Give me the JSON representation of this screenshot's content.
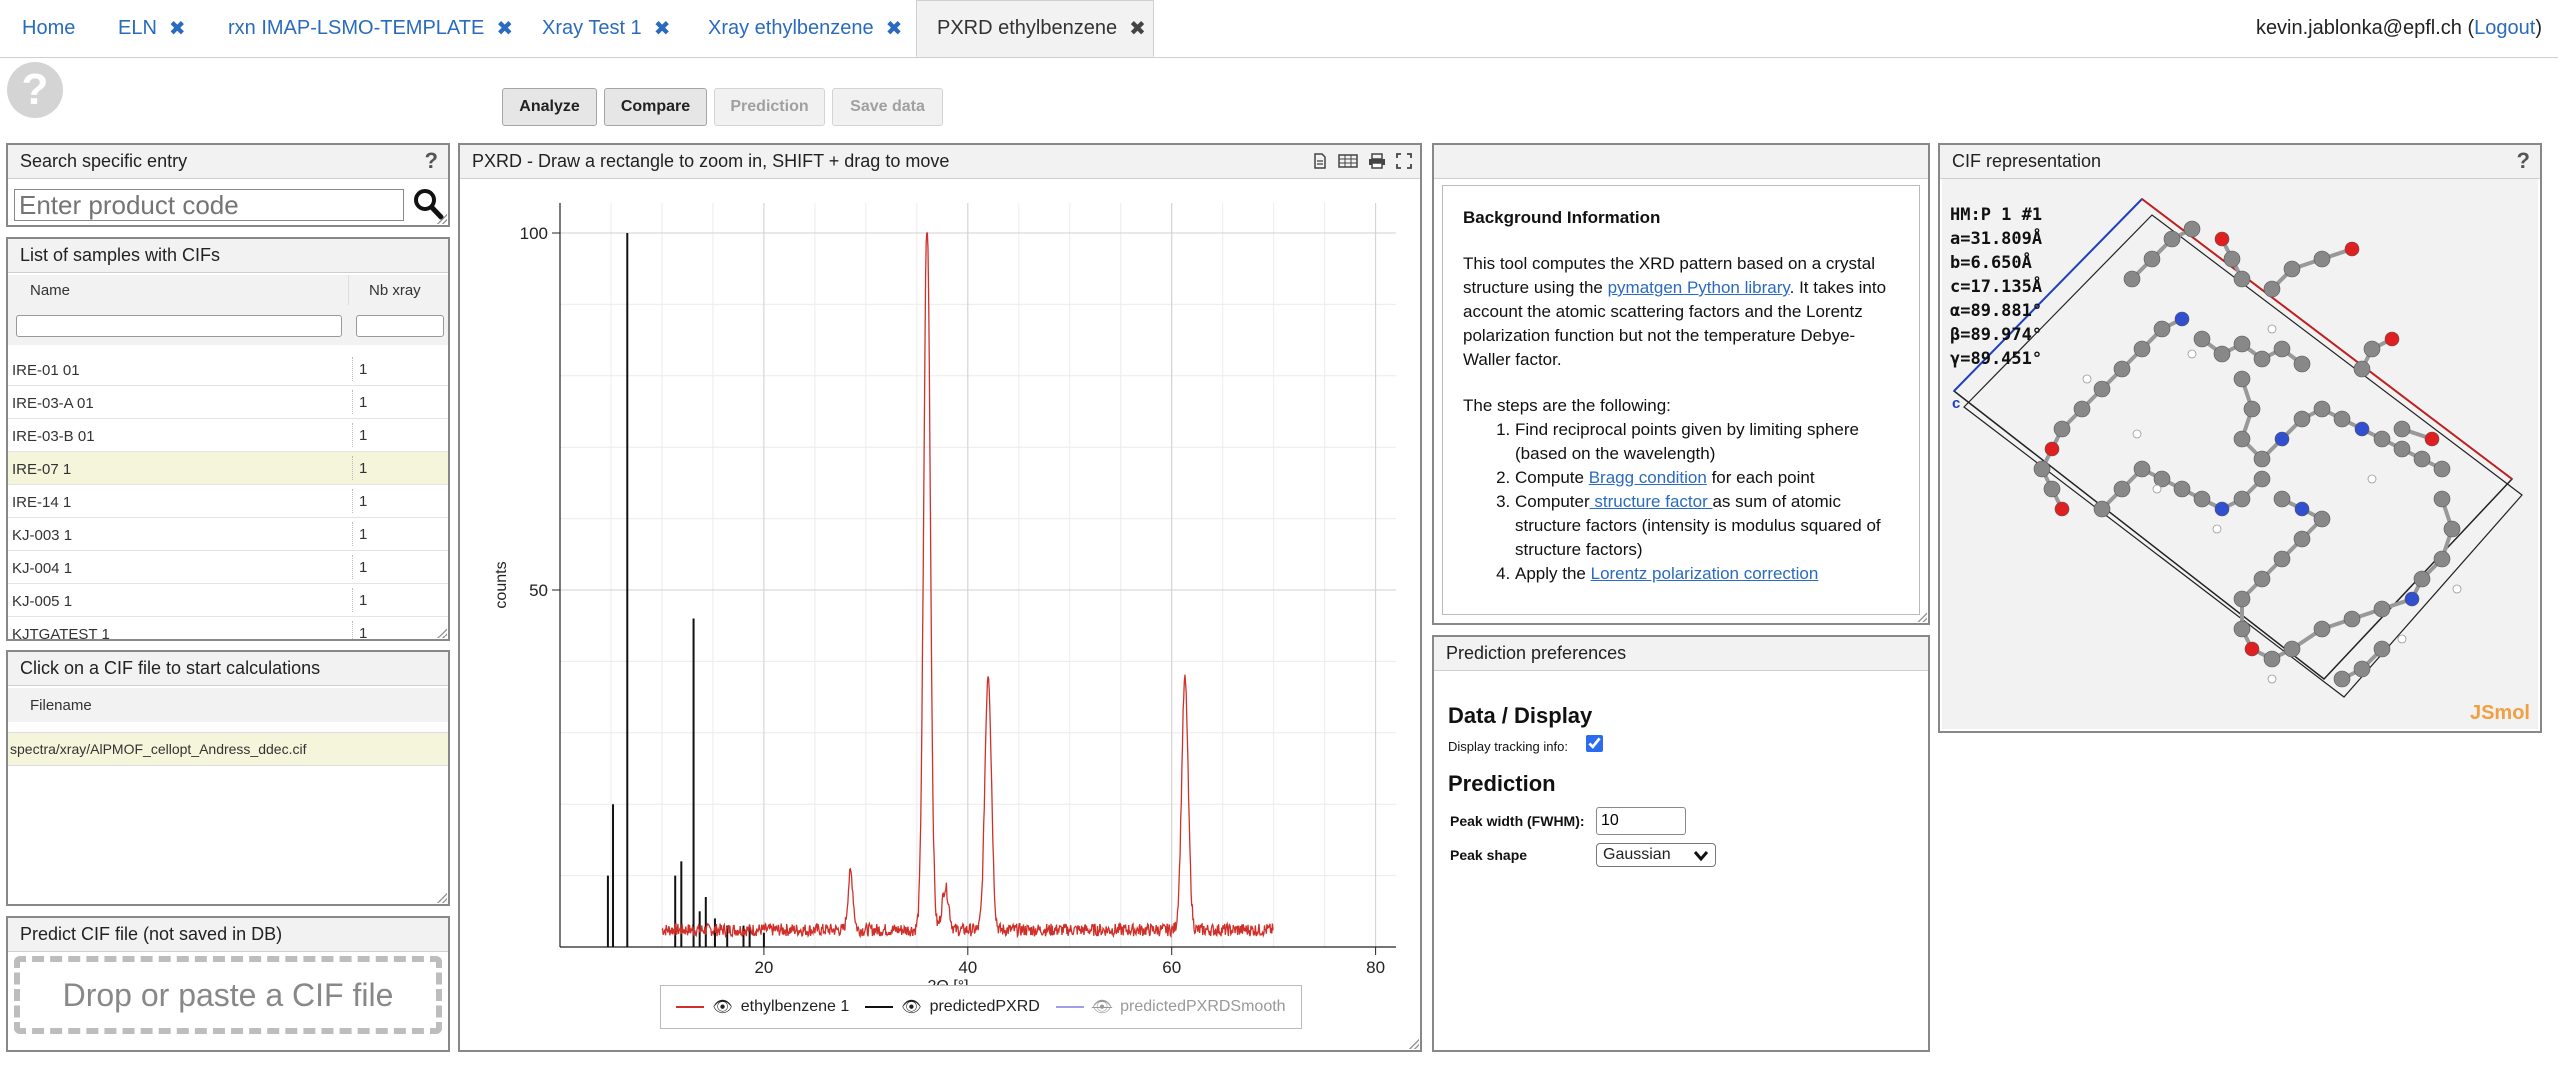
{
  "tabs": [
    {
      "label": "Home",
      "closable": false
    },
    {
      "label": "ELN",
      "closable": true
    },
    {
      "label": "rxn IMAP-LSMO-TEMPLATE",
      "closable": true
    },
    {
      "label": "Xray Test 1",
      "closable": true
    },
    {
      "label": "Xray ethylbenzene",
      "closable": true
    },
    {
      "label": "PXRD ethylbenzene",
      "closable": true,
      "active": true
    }
  ],
  "user": {
    "email": "kevin.jablonka@epfl.ch",
    "open_paren": "(",
    "logout": "Logout",
    "close_paren": ")"
  },
  "help_symbol": "?",
  "toolbar": {
    "analyze": "Analyze",
    "compare": "Compare",
    "prediction": "Prediction",
    "save": "Save data"
  },
  "search": {
    "title": "Search specific entry",
    "placeholder": "Enter product code",
    "help": "?"
  },
  "samples": {
    "title": "List of samples with CIFs",
    "col_name": "Name",
    "col_nb": "Nb xray",
    "rows": [
      {
        "name": "IRE-01 01",
        "nb": "1"
      },
      {
        "name": "IRE-03-A 01",
        "nb": "1"
      },
      {
        "name": "IRE-03-B 01",
        "nb": "1"
      },
      {
        "name": "IRE-07 1",
        "nb": "1",
        "selected": true
      },
      {
        "name": "IRE-14 1",
        "nb": "1"
      },
      {
        "name": "KJ-003 1",
        "nb": "1"
      },
      {
        "name": "KJ-004 1",
        "nb": "1"
      },
      {
        "name": "KJ-005 1",
        "nb": "1"
      },
      {
        "name": "KJTGATEST 1",
        "nb": "1"
      }
    ]
  },
  "cif_files": {
    "title": "Click on a CIF file to start calculations",
    "col": "Filename",
    "rows": [
      "spectra/xray/AlPMOF_cellopt_Andress_ddec.cif"
    ]
  },
  "predict": {
    "title": "Predict CIF file (not saved in DB)",
    "drop": "Drop or paste a CIF file"
  },
  "chart_panel": {
    "title": "PXRD - Draw a rectangle to zoom in, SHIFT + drag to move"
  },
  "chart_data": {
    "type": "line",
    "xlabel": "2Θ [°]",
    "ylabel": "counts",
    "xlim": [
      0,
      82
    ],
    "ylim": [
      0,
      100
    ],
    "xticks": [
      20,
      40,
      60,
      80
    ],
    "yticks": [
      50,
      100
    ],
    "grid": true,
    "legend_position": "bottom",
    "series": [
      {
        "name": "ethylbenzene 1",
        "color": "#d0302a",
        "style": "line",
        "peaks": [
          [
            28.5,
            8
          ],
          [
            36,
            100
          ],
          [
            37.8,
            6
          ],
          [
            42,
            36
          ],
          [
            61.3,
            35
          ]
        ],
        "x_range": [
          10,
          70
        ],
        "baseline": 1.5
      },
      {
        "name": "predictedPXRD",
        "color": "#111111",
        "style": "stick",
        "sticks": [
          [
            4.7,
            10
          ],
          [
            5.2,
            20
          ],
          [
            6.6,
            100
          ],
          [
            11.3,
            10
          ],
          [
            11.9,
            12
          ],
          [
            13.1,
            46
          ],
          [
            13.7,
            5
          ],
          [
            14.3,
            7
          ],
          [
            15.2,
            4
          ],
          [
            16.4,
            3
          ],
          [
            18.0,
            3
          ],
          [
            18.6,
            3
          ],
          [
            20.0,
            2
          ]
        ]
      },
      {
        "name": "predictedPXRDSmooth",
        "color": "#8080e0",
        "style": "line",
        "hidden": true
      }
    ]
  },
  "info": {
    "heading": "Background Information",
    "p1_before": "This tool computes the XRD pattern based on a crystal structure using the ",
    "p1_link": "pymatgen Python library",
    "p1_after": ". It takes into account the atomic scattering factors and the Lorentz polarization function but not the temperature Debye-Waller factor.",
    "steps_intro": "The steps are the following:",
    "step1": "Find reciprocal points given by limiting sphere (based on the wavelength)",
    "step2_before": "Compute ",
    "step2_link": "Bragg condition",
    "step2_after": " for each point",
    "step3_before": "Computer",
    "step3_link": " structure factor ",
    "step3_after": "as sum of atomic structure factors (intensity is modulus squared of structure factors)",
    "step4_before": "Apply the ",
    "step4_link": "Lorentz polarization correction"
  },
  "prefs": {
    "title": "Prediction preferences",
    "h_display": "Data / Display",
    "tracking_label": "Display tracking info:",
    "tracking_checked": true,
    "h_prediction": "Prediction",
    "peak_width_label": "Peak width (FWHM):",
    "peak_width_value": "10",
    "peak_shape_label": "Peak shape",
    "peak_shape_value": "Gaussian"
  },
  "cif": {
    "title": "CIF representation",
    "help": "?",
    "lines": [
      "HM:P 1 #1",
      "a=31.809Å",
      "b=6.650Å",
      "c=17.135Å",
      "α=89.881°",
      "β=89.974°",
      "γ=89.451°"
    ],
    "axis_label_c": "c",
    "watermark": "JSmol"
  }
}
